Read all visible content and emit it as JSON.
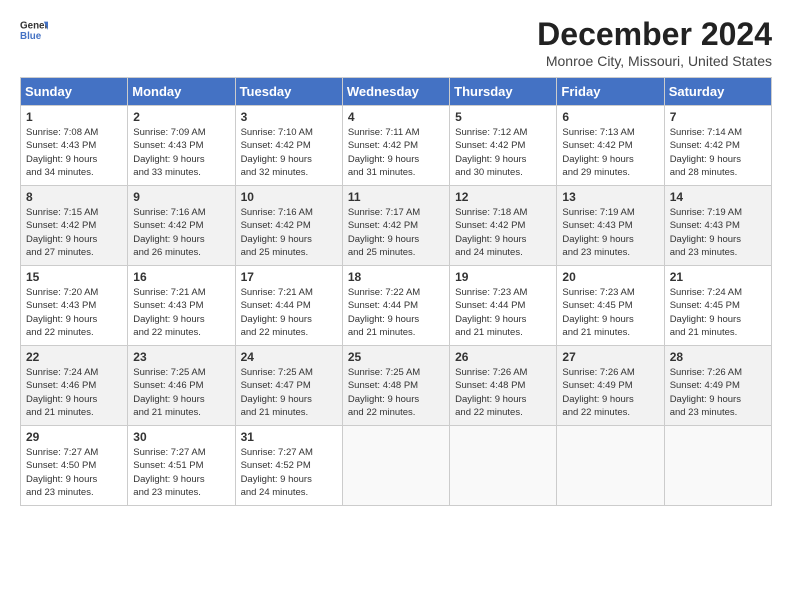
{
  "logo": {
    "line1": "General",
    "line2": "Blue"
  },
  "title": "December 2024",
  "subtitle": "Monroe City, Missouri, United States",
  "days_of_week": [
    "Sunday",
    "Monday",
    "Tuesday",
    "Wednesday",
    "Thursday",
    "Friday",
    "Saturday"
  ],
  "weeks": [
    [
      {
        "day": 1,
        "info": "Sunrise: 7:08 AM\nSunset: 4:43 PM\nDaylight: 9 hours\nand 34 minutes."
      },
      {
        "day": 2,
        "info": "Sunrise: 7:09 AM\nSunset: 4:43 PM\nDaylight: 9 hours\nand 33 minutes."
      },
      {
        "day": 3,
        "info": "Sunrise: 7:10 AM\nSunset: 4:42 PM\nDaylight: 9 hours\nand 32 minutes."
      },
      {
        "day": 4,
        "info": "Sunrise: 7:11 AM\nSunset: 4:42 PM\nDaylight: 9 hours\nand 31 minutes."
      },
      {
        "day": 5,
        "info": "Sunrise: 7:12 AM\nSunset: 4:42 PM\nDaylight: 9 hours\nand 30 minutes."
      },
      {
        "day": 6,
        "info": "Sunrise: 7:13 AM\nSunset: 4:42 PM\nDaylight: 9 hours\nand 29 minutes."
      },
      {
        "day": 7,
        "info": "Sunrise: 7:14 AM\nSunset: 4:42 PM\nDaylight: 9 hours\nand 28 minutes."
      }
    ],
    [
      {
        "day": 8,
        "info": "Sunrise: 7:15 AM\nSunset: 4:42 PM\nDaylight: 9 hours\nand 27 minutes."
      },
      {
        "day": 9,
        "info": "Sunrise: 7:16 AM\nSunset: 4:42 PM\nDaylight: 9 hours\nand 26 minutes."
      },
      {
        "day": 10,
        "info": "Sunrise: 7:16 AM\nSunset: 4:42 PM\nDaylight: 9 hours\nand 25 minutes."
      },
      {
        "day": 11,
        "info": "Sunrise: 7:17 AM\nSunset: 4:42 PM\nDaylight: 9 hours\nand 25 minutes."
      },
      {
        "day": 12,
        "info": "Sunrise: 7:18 AM\nSunset: 4:42 PM\nDaylight: 9 hours\nand 24 minutes."
      },
      {
        "day": 13,
        "info": "Sunrise: 7:19 AM\nSunset: 4:43 PM\nDaylight: 9 hours\nand 23 minutes."
      },
      {
        "day": 14,
        "info": "Sunrise: 7:19 AM\nSunset: 4:43 PM\nDaylight: 9 hours\nand 23 minutes."
      }
    ],
    [
      {
        "day": 15,
        "info": "Sunrise: 7:20 AM\nSunset: 4:43 PM\nDaylight: 9 hours\nand 22 minutes."
      },
      {
        "day": 16,
        "info": "Sunrise: 7:21 AM\nSunset: 4:43 PM\nDaylight: 9 hours\nand 22 minutes."
      },
      {
        "day": 17,
        "info": "Sunrise: 7:21 AM\nSunset: 4:44 PM\nDaylight: 9 hours\nand 22 minutes."
      },
      {
        "day": 18,
        "info": "Sunrise: 7:22 AM\nSunset: 4:44 PM\nDaylight: 9 hours\nand 21 minutes."
      },
      {
        "day": 19,
        "info": "Sunrise: 7:23 AM\nSunset: 4:44 PM\nDaylight: 9 hours\nand 21 minutes."
      },
      {
        "day": 20,
        "info": "Sunrise: 7:23 AM\nSunset: 4:45 PM\nDaylight: 9 hours\nand 21 minutes."
      },
      {
        "day": 21,
        "info": "Sunrise: 7:24 AM\nSunset: 4:45 PM\nDaylight: 9 hours\nand 21 minutes."
      }
    ],
    [
      {
        "day": 22,
        "info": "Sunrise: 7:24 AM\nSunset: 4:46 PM\nDaylight: 9 hours\nand 21 minutes."
      },
      {
        "day": 23,
        "info": "Sunrise: 7:25 AM\nSunset: 4:46 PM\nDaylight: 9 hours\nand 21 minutes."
      },
      {
        "day": 24,
        "info": "Sunrise: 7:25 AM\nSunset: 4:47 PM\nDaylight: 9 hours\nand 21 minutes."
      },
      {
        "day": 25,
        "info": "Sunrise: 7:25 AM\nSunset: 4:48 PM\nDaylight: 9 hours\nand 22 minutes."
      },
      {
        "day": 26,
        "info": "Sunrise: 7:26 AM\nSunset: 4:48 PM\nDaylight: 9 hours\nand 22 minutes."
      },
      {
        "day": 27,
        "info": "Sunrise: 7:26 AM\nSunset: 4:49 PM\nDaylight: 9 hours\nand 22 minutes."
      },
      {
        "day": 28,
        "info": "Sunrise: 7:26 AM\nSunset: 4:49 PM\nDaylight: 9 hours\nand 23 minutes."
      }
    ],
    [
      {
        "day": 29,
        "info": "Sunrise: 7:27 AM\nSunset: 4:50 PM\nDaylight: 9 hours\nand 23 minutes."
      },
      {
        "day": 30,
        "info": "Sunrise: 7:27 AM\nSunset: 4:51 PM\nDaylight: 9 hours\nand 23 minutes."
      },
      {
        "day": 31,
        "info": "Sunrise: 7:27 AM\nSunset: 4:52 PM\nDaylight: 9 hours\nand 24 minutes."
      },
      null,
      null,
      null,
      null
    ]
  ]
}
